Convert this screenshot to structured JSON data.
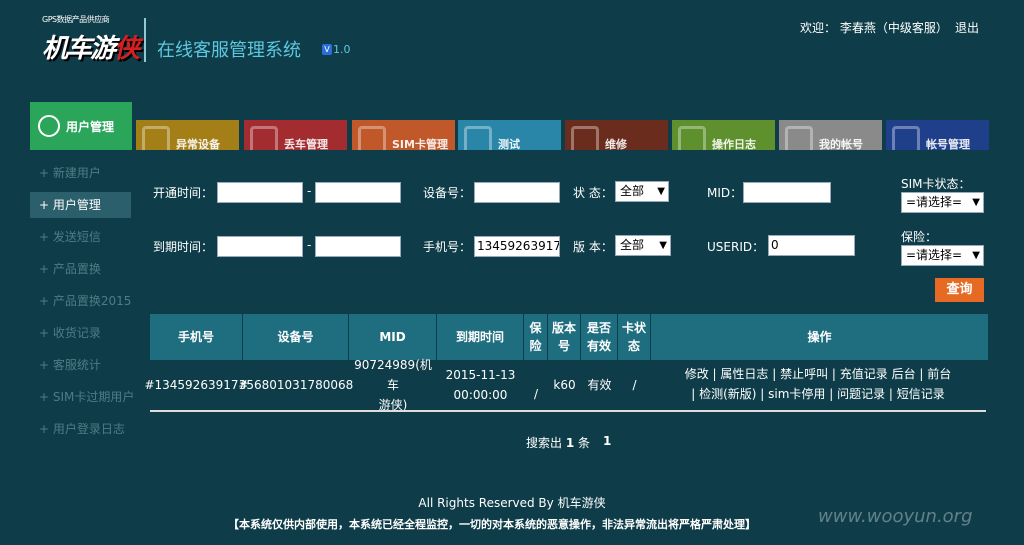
{
  "header": {
    "logo_tagline": "GPS数据产品供应商",
    "logo_text_a": "机车游",
    "logo_text_b": "侠",
    "app_title": "在线客服管理系统",
    "version_badge": "V",
    "version": "1.0",
    "welcome": "欢迎：  李春燕（中级客服）",
    "logout": "退出"
  },
  "nav": {
    "active": "用户管理",
    "tiles": [
      "异常设备",
      "丢车管理",
      "SIM卡管理",
      "测试",
      "维修",
      "操作日志",
      "我的帐号",
      "帐号管理"
    ],
    "tile_colors": [
      "#a47f18",
      "#a32c30",
      "#c0582a",
      "#2a86a8",
      "#6a2c1c",
      "#5f902e",
      "#8a8a8a",
      "#1f3f8a"
    ]
  },
  "sidebar": {
    "items": [
      "+ 新建用户",
      "+ 用户管理",
      "+ 发送短信",
      "+ 产品置换",
      "+ 产品置换2015",
      "+ 收货记录",
      "+ 客服统计",
      "+ SIM卡过期用户",
      "+ 用户登录日志"
    ]
  },
  "form": {
    "open_time_label": "开通时间：",
    "expire_time_label": "到期时间：",
    "dash": "-",
    "device_label": "设备号：",
    "phone_label": "手机号：",
    "phone_value": "13459263917",
    "status_label": "状 态：",
    "status_value": "全部",
    "version_label": "版 本：",
    "version_value": "全部",
    "mid_label": "MID：",
    "userid_label": "USERID：",
    "userid_value": "0",
    "sim_status_label": "SIM卡状态：",
    "sim_status_value": "=请选择=",
    "insurance_label": "保险：",
    "insurance_value": "=请选择=",
    "query_button": "查询"
  },
  "table": {
    "headers": [
      "手机号",
      "设备号",
      "MID",
      "到期时间",
      "保险",
      "版本号",
      "是否有效",
      "卡状态",
      "操作"
    ],
    "row": {
      "phone": "#13459263917#",
      "device": "356801031780068",
      "mid_line1": "90724989(机车",
      "mid_line2": "游侠)",
      "expire_line1": "2015-11-13",
      "expire_line2": "00:00:00",
      "insurance": "/",
      "version": "k60",
      "valid": "有效",
      "card_status": "/",
      "ops_line1": "修改  |  属性日志  |  禁止呼叫  |  充值记录      后台  |  前台",
      "ops_line2": "|  检测(新版)  |  sim卡停用  |  问题记录  |  短信记录"
    }
  },
  "pagination": {
    "prefix": "搜索出",
    "total": "1",
    "suffix": "条",
    "page": "1"
  },
  "footer": {
    "rights": "All Rights Reserved By 机车游侠",
    "notice": "【本系统仅供内部使用，本系统已经全程监控，一切的对本系统的恶意操作，非法异常流出将严格严肃处理】",
    "watermark": "www.wooyun.org"
  }
}
